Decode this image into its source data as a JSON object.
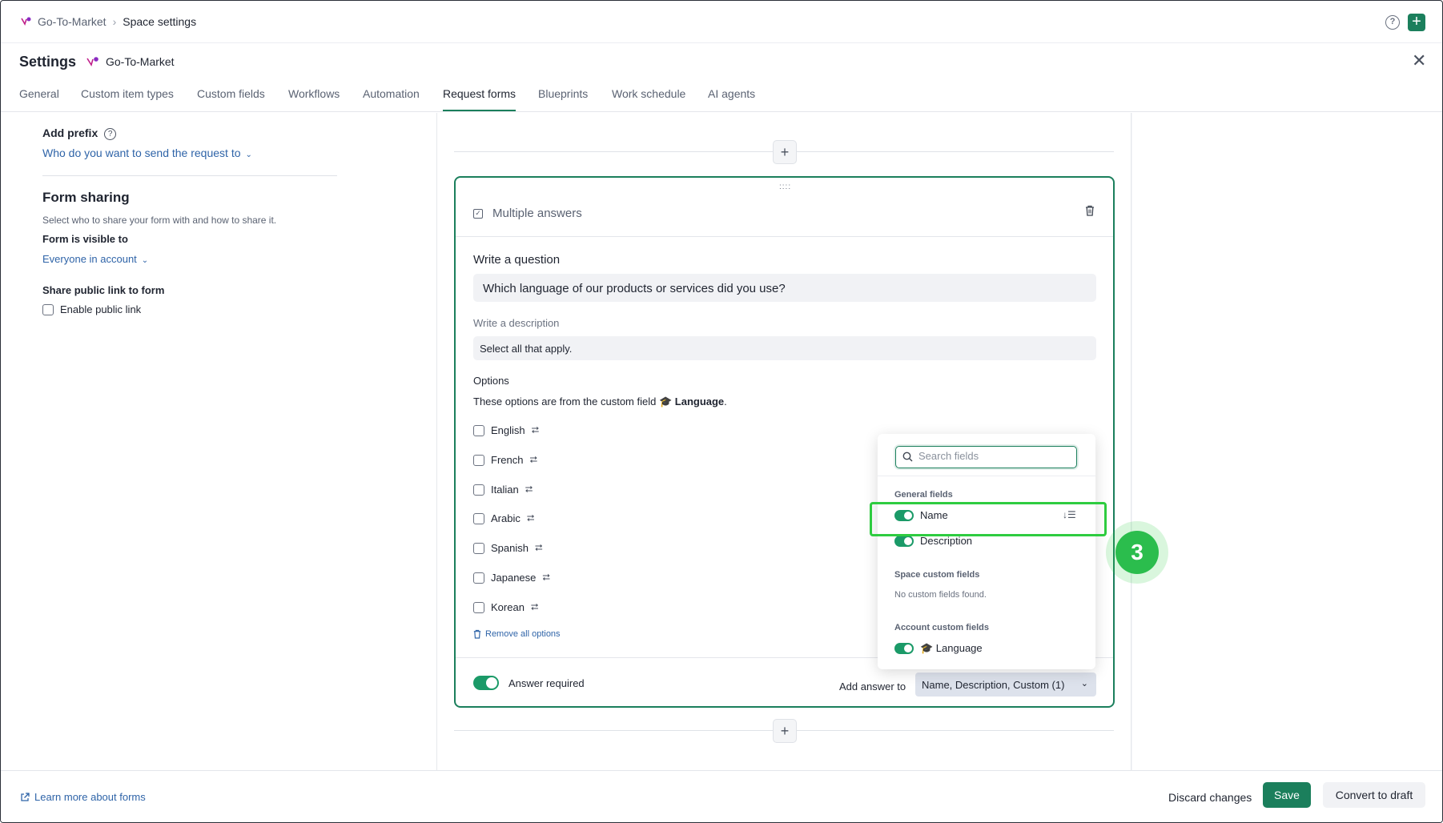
{
  "breadcrumb": {
    "space": "Go-To-Market",
    "current": "Space settings"
  },
  "header": {
    "title": "Settings",
    "space_name": "Go-To-Market"
  },
  "tabs": [
    {
      "label": "General"
    },
    {
      "label": "Custom item types"
    },
    {
      "label": "Custom fields"
    },
    {
      "label": "Workflows"
    },
    {
      "label": "Automation"
    },
    {
      "label": "Request forms"
    },
    {
      "label": "Blueprints"
    },
    {
      "label": "Work schedule"
    },
    {
      "label": "AI agents"
    }
  ],
  "active_tab": "Request forms",
  "left_panel": {
    "add_prefix_label": "Add prefix",
    "send_request_dd": "Who do you want to send the request to",
    "form_sharing_title": "Form sharing",
    "form_sharing_sub": "Select who to share your form with and how to share it.",
    "visible_to_label": "Form is visible to",
    "visible_to_value": "Everyone in account",
    "share_link_label": "Share public link to form",
    "enable_public_link": "Enable public link"
  },
  "question_card": {
    "type_label": "Multiple answers",
    "question_label": "Write a question",
    "question_value": "Which language of our products or services did you use?",
    "description_label": "Write a description",
    "description_value": "Select all that apply.",
    "options_label": "Options",
    "options_note_prefix": "These options are from the custom field",
    "options_note_field": "🎓 Language",
    "options_note_suffix": ".",
    "options": [
      "English",
      "French",
      "Italian",
      "Arabic",
      "Spanish",
      "Japanese",
      "Korean"
    ],
    "remove_all": "Remove all options",
    "answer_required": "Answer required",
    "add_answer_to_label": "Add answer to",
    "add_answer_to_value": "Name, Description, Custom (1)"
  },
  "field_dropdown": {
    "search_placeholder": "Search fields",
    "general_fields_title": "General fields",
    "general_fields": [
      "Name",
      "Description"
    ],
    "space_custom_title": "Space custom fields",
    "space_custom_empty": "No custom fields found.",
    "account_custom_title": "Account custom fields",
    "account_custom_fields": [
      "🎓 Language"
    ]
  },
  "step_marker": "3",
  "footer": {
    "learn_more": "Learn more about forms",
    "discard": "Discard changes",
    "save": "Save",
    "convert": "Convert to draft"
  },
  "colors": {
    "accent": "#1b7f5c",
    "link": "#2f64a8",
    "highlight": "#2ecc40"
  }
}
